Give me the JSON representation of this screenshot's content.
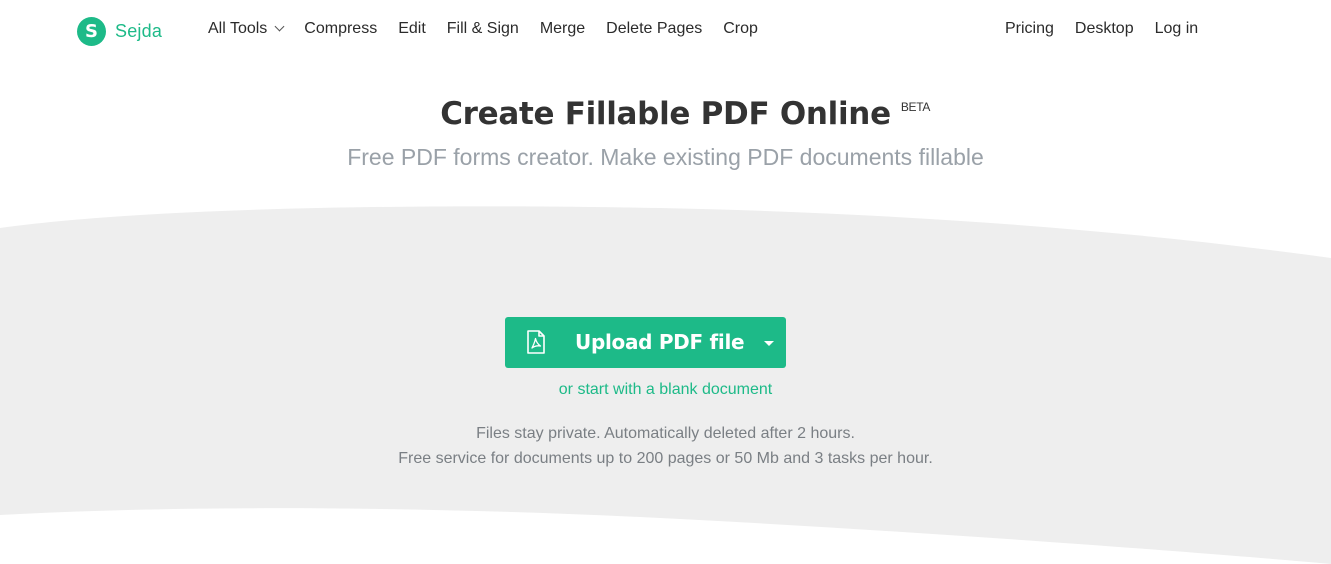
{
  "brand": {
    "logo_letter": "S",
    "name": "Sejda",
    "color": "#1dba88"
  },
  "nav": {
    "all_tools": "All Tools",
    "items": [
      "Compress",
      "Edit",
      "Fill & Sign",
      "Merge",
      "Delete Pages",
      "Crop"
    ],
    "right": [
      "Pricing",
      "Desktop",
      "Log in"
    ]
  },
  "hero": {
    "title": "Create Fillable PDF Online",
    "badge": "BETA",
    "subtitle": "Free PDF forms creator. Make existing PDF documents fillable"
  },
  "upload": {
    "button_label": "Upload PDF file",
    "icon": "pdf-file-icon",
    "dropdown_icon": "caret-down-icon",
    "blank_link": "or start with a blank document"
  },
  "notes": {
    "privacy": "Files stay private. Automatically deleted after 2 hours.",
    "limits": "Free service for documents up to 200 pages or 50 Mb and 3 tasks per hour."
  },
  "colors": {
    "accent": "#1dba88",
    "panel": "#eeeeee",
    "heading": "#333333",
    "muted": "#9aa1a8"
  }
}
